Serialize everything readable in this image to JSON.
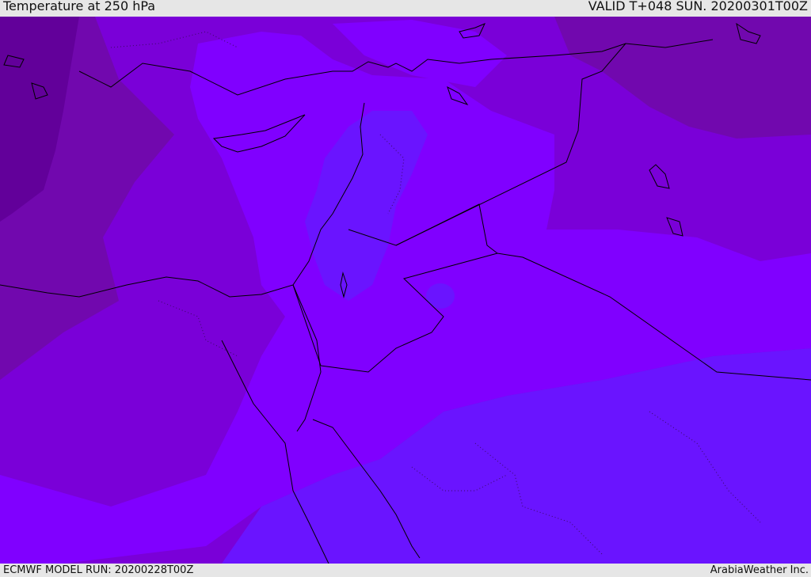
{
  "header": {
    "title": "Temperature at 250 hPa",
    "valid_time": "VALID T+048 SUN. 20200301T00Z"
  },
  "footer": {
    "model_run": "ECMWF MODEL RUN: 20200228T00Z",
    "credit": "ArabiaWeather Inc."
  },
  "colors": {
    "darkest": "#62009a",
    "dark": "#7108ae",
    "mid": "#7a00d8",
    "bright": "#8000ff",
    "blue_violet": "#6a14ff",
    "coast": "#000000"
  }
}
